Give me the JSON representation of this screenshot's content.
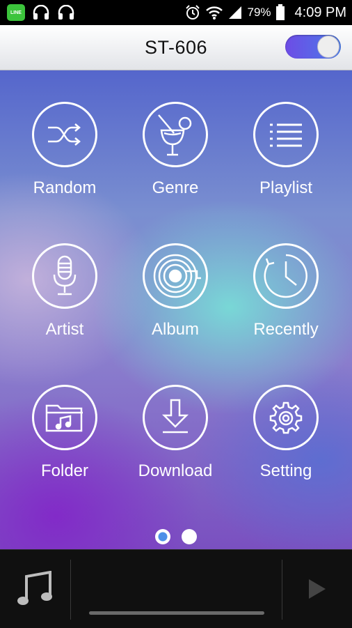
{
  "status_bar": {
    "line_label": "LINE",
    "battery_percent": "79%",
    "time": "4:09 PM"
  },
  "header": {
    "title": "ST-606",
    "toggle_on": true
  },
  "menu": [
    {
      "label": "Random",
      "icon": "shuffle-icon"
    },
    {
      "label": "Genre",
      "icon": "cocktail-icon"
    },
    {
      "label": "Playlist",
      "icon": "list-icon"
    },
    {
      "label": "Artist",
      "icon": "microphone-icon"
    },
    {
      "label": "Album",
      "icon": "vinyl-icon"
    },
    {
      "label": "Recently",
      "icon": "clock-icon"
    },
    {
      "label": "Folder",
      "icon": "music-folder-icon"
    },
    {
      "label": "Download",
      "icon": "download-icon"
    },
    {
      "label": "Setting",
      "icon": "gear-icon"
    }
  ],
  "pager": {
    "page_count": 2,
    "current_page": 1
  },
  "player": {
    "progress": 0
  }
}
